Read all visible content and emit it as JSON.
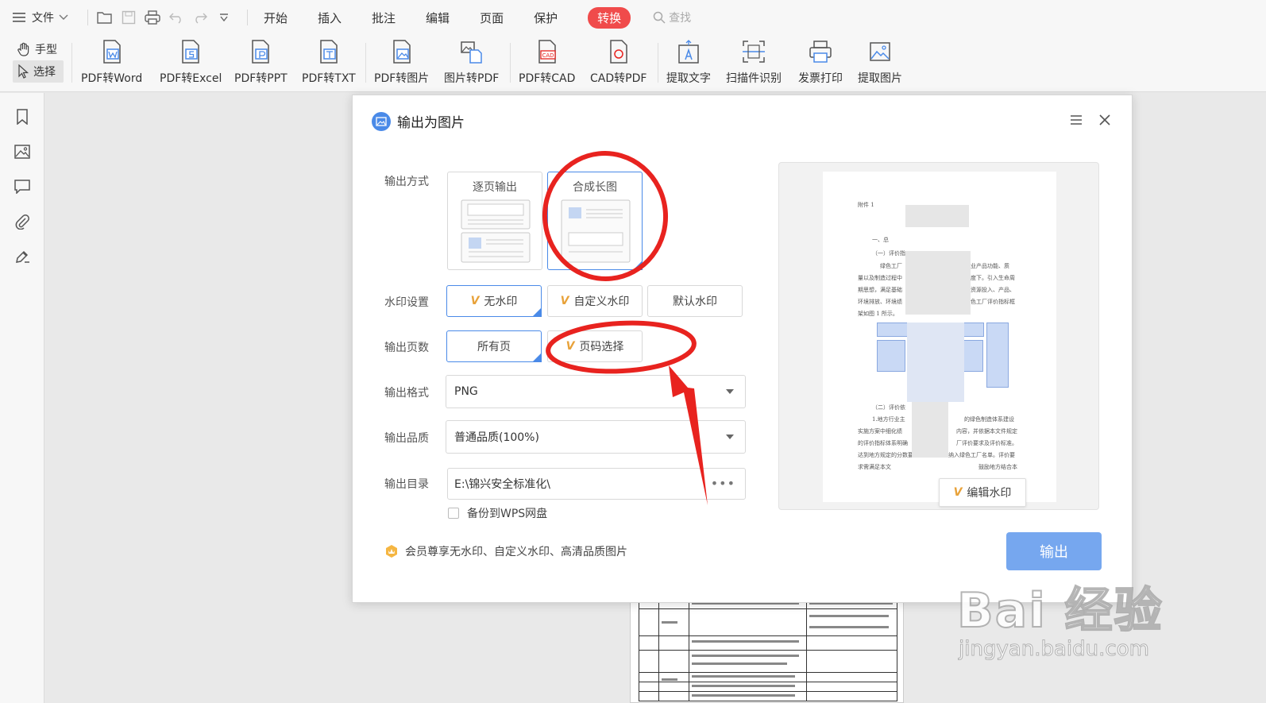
{
  "menubar": {
    "file_label": "文件",
    "tabs": [
      {
        "label": "开始",
        "active": false
      },
      {
        "label": "插入",
        "active": false
      },
      {
        "label": "批注",
        "active": false
      },
      {
        "label": "编辑",
        "active": false
      },
      {
        "label": "页面",
        "active": false
      },
      {
        "label": "保护",
        "active": false
      },
      {
        "label": "转换",
        "active": true
      }
    ],
    "search_placeholder": "查找"
  },
  "ribbon": {
    "hand_label": "手型",
    "select_label": "选择",
    "buttons": [
      {
        "label": "PDF转Word",
        "icon": "pdf-to-word-icon"
      },
      {
        "label": "PDF转Excel",
        "icon": "pdf-to-excel-icon"
      },
      {
        "label": "PDF转PPT",
        "icon": "pdf-to-ppt-icon"
      },
      {
        "label": "PDF转TXT",
        "icon": "pdf-to-txt-icon"
      },
      {
        "label": "PDF转图片",
        "icon": "pdf-to-image-icon"
      },
      {
        "label": "图片转PDF",
        "icon": "image-to-pdf-icon"
      },
      {
        "label": "PDF转CAD",
        "icon": "pdf-to-cad-icon"
      },
      {
        "label": "CAD转PDF",
        "icon": "cad-to-pdf-icon"
      },
      {
        "label": "提取文字",
        "icon": "extract-text-icon"
      },
      {
        "label": "扫描件识别",
        "icon": "scan-recognition-icon"
      },
      {
        "label": "发票打印",
        "icon": "invoice-print-icon"
      },
      {
        "label": "提取图片",
        "icon": "extract-image-icon"
      }
    ]
  },
  "dialog": {
    "title": "输出为图片",
    "output_mode": {
      "label": "输出方式",
      "options": [
        "逐页输出",
        "合成长图"
      ],
      "selected": "合成长图"
    },
    "watermark": {
      "label": "水印设置",
      "options": [
        "无水印",
        "自定义水印",
        "默认水印"
      ],
      "selected": "无水印"
    },
    "pages": {
      "label": "输出页数",
      "options": [
        "所有页",
        "页码选择"
      ],
      "selected": "所有页"
    },
    "format": {
      "label": "输出格式",
      "value": "PNG"
    },
    "quality": {
      "label": "输出品质",
      "value": "普通品质(100%)"
    },
    "directory": {
      "label": "输出目录",
      "value": "E:\\锦兴安全标准化\\",
      "more": "•••"
    },
    "backup_label": "备份到WPS网盘",
    "vip_note": "会员尊享无水印、自定义水印、高清品质图片",
    "export_label": "输出",
    "preview": {
      "edit_watermark_label": "编辑水印",
      "lines": [
        "附件 1",
        "一、总",
        "（一）评价指",
        "绿色工厂（",
        "业产品功能、质",
        "量以及制造过程中",
        "度下。引入生命周",
        "期思想，满足基础",
        "资源投入、产品、",
        "环境排放、环境绩",
        "色工厂评价指标框",
        "架如图 1 所示。",
        "（二）评价依",
        "1.地方行业主",
        "的绿色制造体系建设",
        "实施方案中细化绩",
        "内容，并依据本文件规定",
        "的评价指标体系明确",
        "厂评价要求及评价标准。",
        "达到地方规定的分数要求",
        "纳入绿色工厂名单。评价要",
        "求需满足本文",
        "鼓励地方结合本"
      ]
    }
  },
  "watermark_brand": {
    "main": "Bai 经验",
    "sub": "jingyan.baidu.com"
  },
  "colors": {
    "accent": "#4a8ae8",
    "active_tab": "#f04b4b",
    "vip": "#e8a23a",
    "export": "#76a7ef",
    "annotation": "#e8231f"
  }
}
